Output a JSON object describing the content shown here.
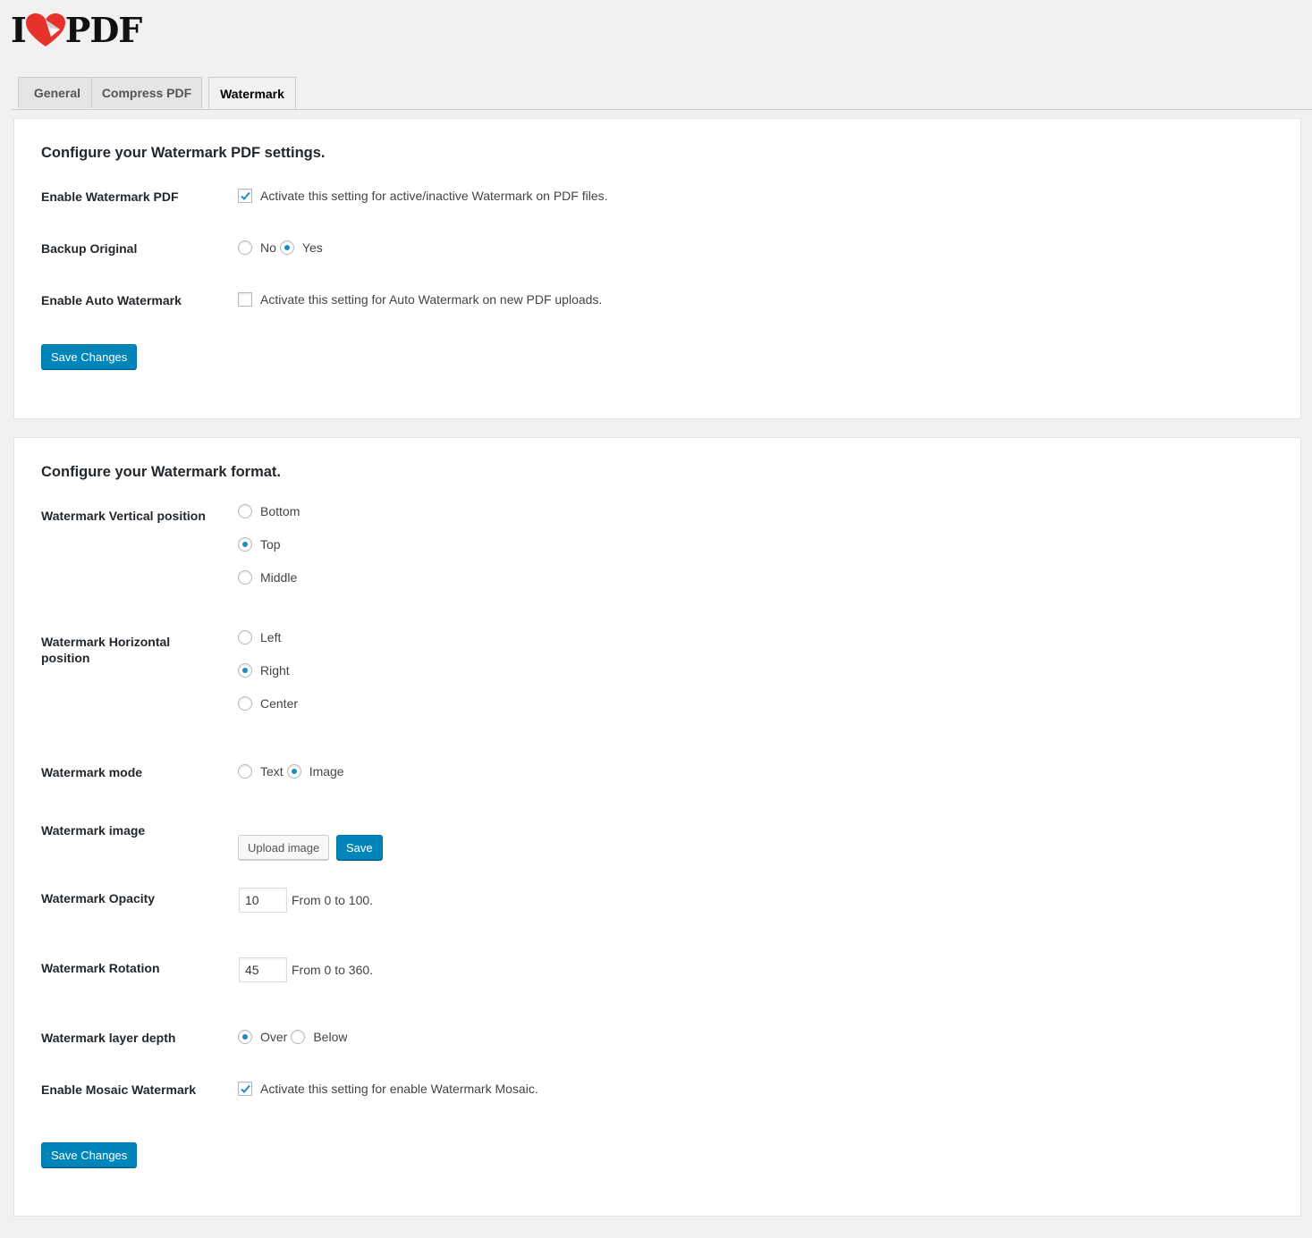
{
  "logo": {
    "text_left": "I",
    "text_right": "PDF"
  },
  "tabs": [
    {
      "label": "General"
    },
    {
      "label": "Compress PDF"
    },
    {
      "label": "Watermark"
    }
  ],
  "settings_card": {
    "title": "Configure your Watermark PDF settings.",
    "enable_watermark": {
      "label": "Enable Watermark PDF",
      "checked": true,
      "description": "Activate this setting for active/inactive Watermark on PDF files."
    },
    "backup_original": {
      "label": "Backup Original",
      "options": [
        "No",
        "Yes"
      ],
      "selected": "Yes"
    },
    "auto_watermark": {
      "label": "Enable Auto Watermark",
      "checked": false,
      "description": "Activate this setting for Auto Watermark on new PDF uploads."
    },
    "save_label": "Save Changes"
  },
  "format_card": {
    "title": "Configure your Watermark format.",
    "vertical_position": {
      "label": "Watermark Vertical position",
      "options": [
        "Bottom",
        "Top",
        "Middle"
      ],
      "selected": "Top"
    },
    "horizontal_position": {
      "label": "Watermark Horizontal position",
      "options": [
        "Left",
        "Right",
        "Center"
      ],
      "selected": "Right"
    },
    "mode": {
      "label": "Watermark mode",
      "options": [
        "Text",
        "Image"
      ],
      "selected": "Image"
    },
    "image": {
      "label": "Watermark image",
      "upload_label": "Upload image",
      "save_label": "Save"
    },
    "opacity": {
      "label": "Watermark Opacity",
      "value": "10",
      "hint": "From 0 to 100."
    },
    "rotation": {
      "label": "Watermark Rotation",
      "value": "45",
      "hint": "From 0 to 360."
    },
    "layer_depth": {
      "label": "Watermark layer depth",
      "options": [
        "Over",
        "Below"
      ],
      "selected": "Over"
    },
    "mosaic": {
      "label": "Enable Mosaic Watermark",
      "checked": true,
      "description": "Activate this setting for enable Watermark Mosaic."
    },
    "save_label": "Save Changes"
  },
  "colors": {
    "primary_button": "#0085ba",
    "logo_heart": "#e5322d",
    "radio_dot": "#1e8cbe"
  },
  "icons": {
    "check": "checkmark-icon",
    "heart": "heart-icon"
  }
}
